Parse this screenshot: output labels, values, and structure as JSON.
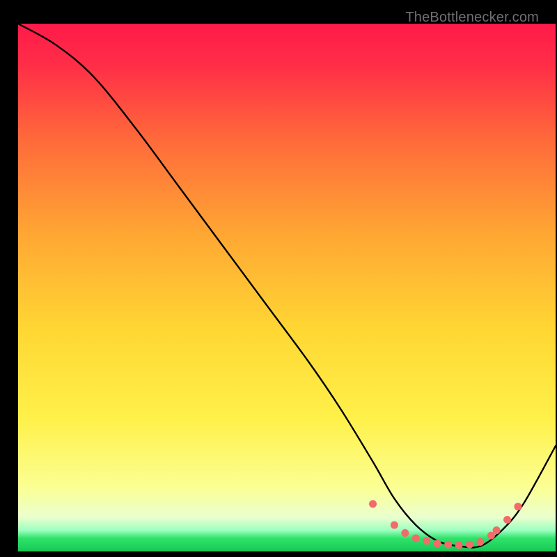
{
  "watermark": "TheBottlenecker.com",
  "colors": {
    "grad_top": "#ff1a49",
    "grad_mid1": "#ff8a2e",
    "grad_mid2": "#ffe436",
    "grad_low": "#f9ffb0",
    "grad_bottom": "#2fe36a",
    "frame": "#000000",
    "curve": "#000000",
    "dots": "#f36a6a"
  },
  "chart_data": {
    "type": "line",
    "title": "",
    "xlabel": "",
    "ylabel": "",
    "xlim": [
      0,
      100
    ],
    "ylim": [
      0,
      100
    ],
    "series": [
      {
        "name": "bottleneck-curve",
        "x": [
          0,
          7,
          14,
          22,
          30,
          38,
          46,
          54,
          60,
          66,
          70,
          74,
          78,
          82,
          86,
          90,
          94,
          100
        ],
        "y": [
          100,
          96,
          90,
          80,
          69,
          58,
          47,
          36,
          27,
          17,
          10,
          5,
          2,
          1,
          1,
          4,
          9,
          20
        ]
      }
    ],
    "markers": {
      "name": "highlight-dots",
      "x": [
        66,
        70,
        72,
        74,
        76,
        78,
        80,
        82,
        84,
        86,
        88,
        89,
        91,
        93
      ],
      "y": [
        9,
        5,
        3.5,
        2.5,
        2,
        1.5,
        1.3,
        1.2,
        1.3,
        1.8,
        3,
        4,
        6,
        8.5
      ]
    }
  }
}
